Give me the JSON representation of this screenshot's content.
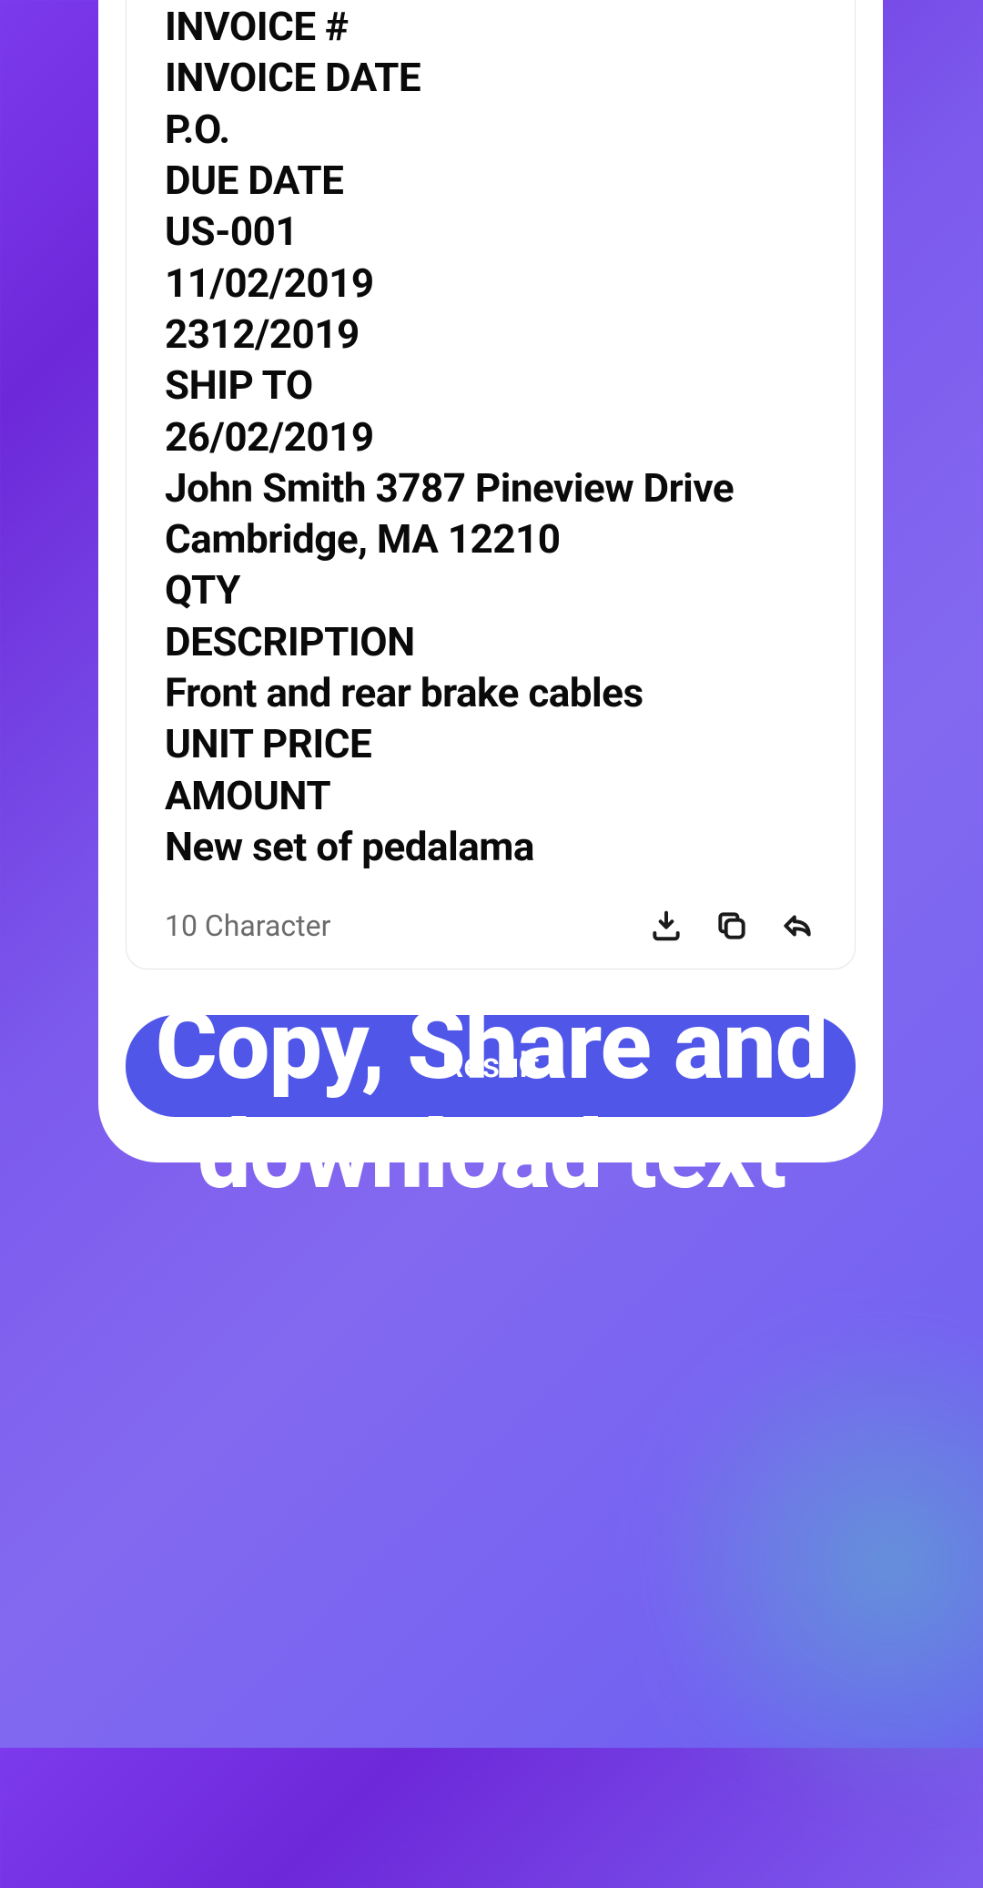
{
  "card": {
    "lines": [
      "INVOICE #",
      "INVOICE DATE",
      "P.O.",
      "DUE DATE",
      "US-001",
      "11/02/2019",
      "2312/2019",
      "SHIP TO",
      "26/02/2019",
      "John Smith 3787 Pineview Drive",
      "Cambridge, MA 12210",
      "QTY",
      "DESCRIPTION",
      "Front and rear brake cables",
      "UNIT PRICE",
      "AMOUNT",
      "New set of pedalama"
    ],
    "char_count": "10 Character"
  },
  "button": {
    "result_label": "Result"
  },
  "marketing": {
    "headline": "Copy, Share and download text"
  }
}
